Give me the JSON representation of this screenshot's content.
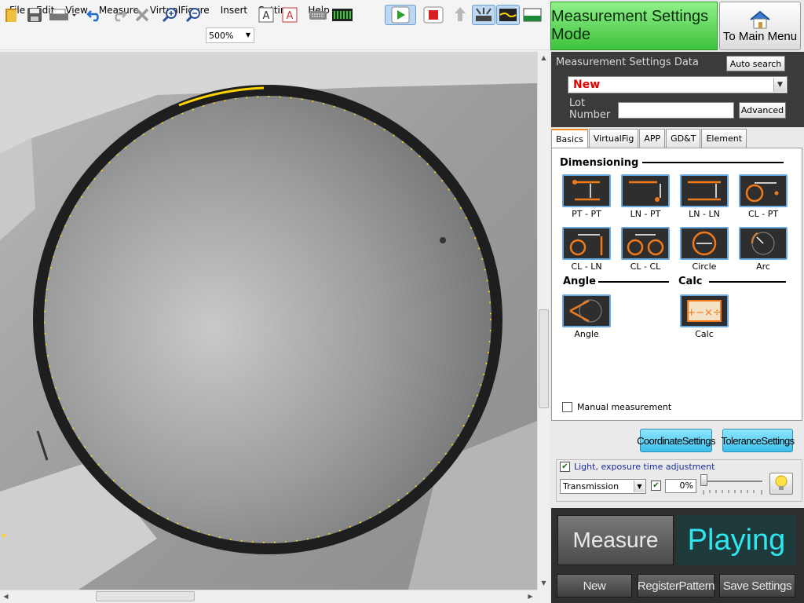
{
  "menu": [
    "File",
    "Edit",
    "View",
    "Measure",
    "VirtualFigure",
    "Insert",
    "Settings",
    "Help"
  ],
  "toolbar": {
    "zoom_value": "500%",
    "icons": [
      "open-icon",
      "save-icon",
      "print-icon",
      "undo-icon",
      "redo-icon",
      "delete-icon",
      "zoom-in-icon",
      "zoom-out-icon",
      "text-edit-icon",
      "text-format-icon",
      "keyboard-icon",
      "level-meter-icon",
      "play-icon",
      "stop-icon",
      "light-up-icon",
      "light-bar-icon",
      "edge-detect-icon",
      "threshold-icon"
    ]
  },
  "header": {
    "mode_label": "Measurement Settings Mode",
    "main_menu_label": "To Main Menu"
  },
  "settings_data": {
    "title": "Measurement Settings Data",
    "auto_search": "Auto search",
    "selected": "New",
    "lot_label": "Lot Number",
    "lot_value": "",
    "advanced": "Advanced"
  },
  "tabs": [
    "Basics",
    "VirtualFig",
    "APP",
    "GD&T",
    "Element"
  ],
  "dimensioning": {
    "title": "Dimensioning",
    "tools": [
      "PT - PT",
      "LN - PT",
      "LN - LN",
      "CL - PT",
      "CL - LN",
      "CL - CL",
      "Circle",
      "Arc"
    ]
  },
  "angle": {
    "title": "Angle",
    "tools": [
      "Angle"
    ]
  },
  "calc": {
    "title": "Calc",
    "tools": [
      "Calc"
    ]
  },
  "manual_measurement": "Manual measurement",
  "buttons": {
    "coordinate": "CoordinateSettings",
    "tolerance": "ToleranceSettings",
    "measure": "Measure",
    "playing": "Playing",
    "new": "New",
    "register": "RegisterPattern",
    "save": "Save Settings"
  },
  "light": {
    "label": "Light, exposure time adjustment",
    "source": "Transmission",
    "percent": "0%"
  },
  "colors": {
    "mode_green": "#4fd24a",
    "accent_cyan": "#3cbfe8",
    "tool_orange": "#f07a1a",
    "edge_yellow": "#ffd400"
  }
}
